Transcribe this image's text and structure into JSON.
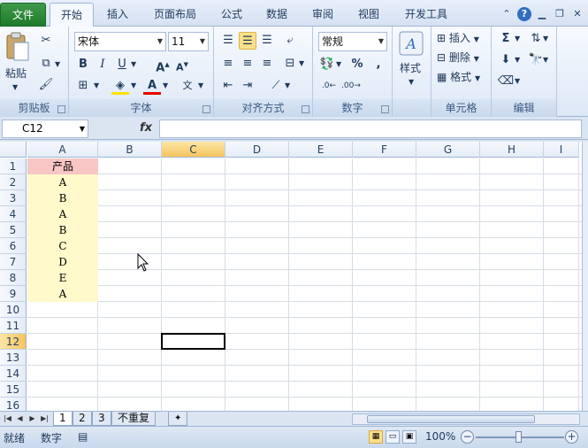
{
  "tabs": [
    {
      "label": "文件",
      "kind": "file"
    },
    {
      "label": "开始",
      "kind": "active"
    },
    {
      "label": "插入",
      "kind": ""
    },
    {
      "label": "页面布局",
      "kind": ""
    },
    {
      "label": "公式",
      "kind": ""
    },
    {
      "label": "数据",
      "kind": ""
    },
    {
      "label": "审阅",
      "kind": ""
    },
    {
      "label": "视图",
      "kind": ""
    },
    {
      "label": "开发工具",
      "kind": ""
    }
  ],
  "window": {
    "help_icon": "?",
    "min_icon": "minimize-icon",
    "restore_icon": "restore-icon",
    "close_icon": "close-icon"
  },
  "ribbon": {
    "clipboard": {
      "label": "剪贴板",
      "paste_label": "粘贴"
    },
    "font": {
      "label": "字体",
      "font_name": "宋体",
      "font_size": "11"
    },
    "alignment": {
      "label": "对齐方式"
    },
    "number": {
      "label": "数字",
      "format": "常规",
      "percent": "%",
      "comma": ","
    },
    "styles": {
      "label": "样式"
    },
    "cells": {
      "label": "单元格",
      "insert": "插入",
      "delete": "删除",
      "format": "格式"
    },
    "editing": {
      "label": "编辑"
    }
  },
  "formula_bar": {
    "name_box": "C12",
    "fx": "fx",
    "value": ""
  },
  "columns": [
    "A",
    "B",
    "C",
    "D",
    "E",
    "F",
    "G",
    "H",
    "I"
  ],
  "active_column": "C",
  "rows": [
    "1",
    "2",
    "3",
    "4",
    "5",
    "6",
    "7",
    "8",
    "9",
    "10",
    "11",
    "12",
    "13",
    "14",
    "15",
    "16"
  ],
  "active_row": "12",
  "column_a": [
    "产品",
    "A",
    "B",
    "A",
    "B",
    "C",
    "D",
    "E",
    "A"
  ],
  "colors": {
    "header_cell": "#f7c6c5",
    "data_cells": "#fff9cc",
    "accent": "#f5c45e"
  },
  "sheets": [
    {
      "label": "1",
      "active": true
    },
    {
      "label": "2",
      "active": false
    },
    {
      "label": "3",
      "active": false
    },
    {
      "label": "不重复",
      "active": false
    }
  ],
  "status": {
    "ready": "就绪",
    "mode": "数字",
    "zoom": "100%"
  }
}
